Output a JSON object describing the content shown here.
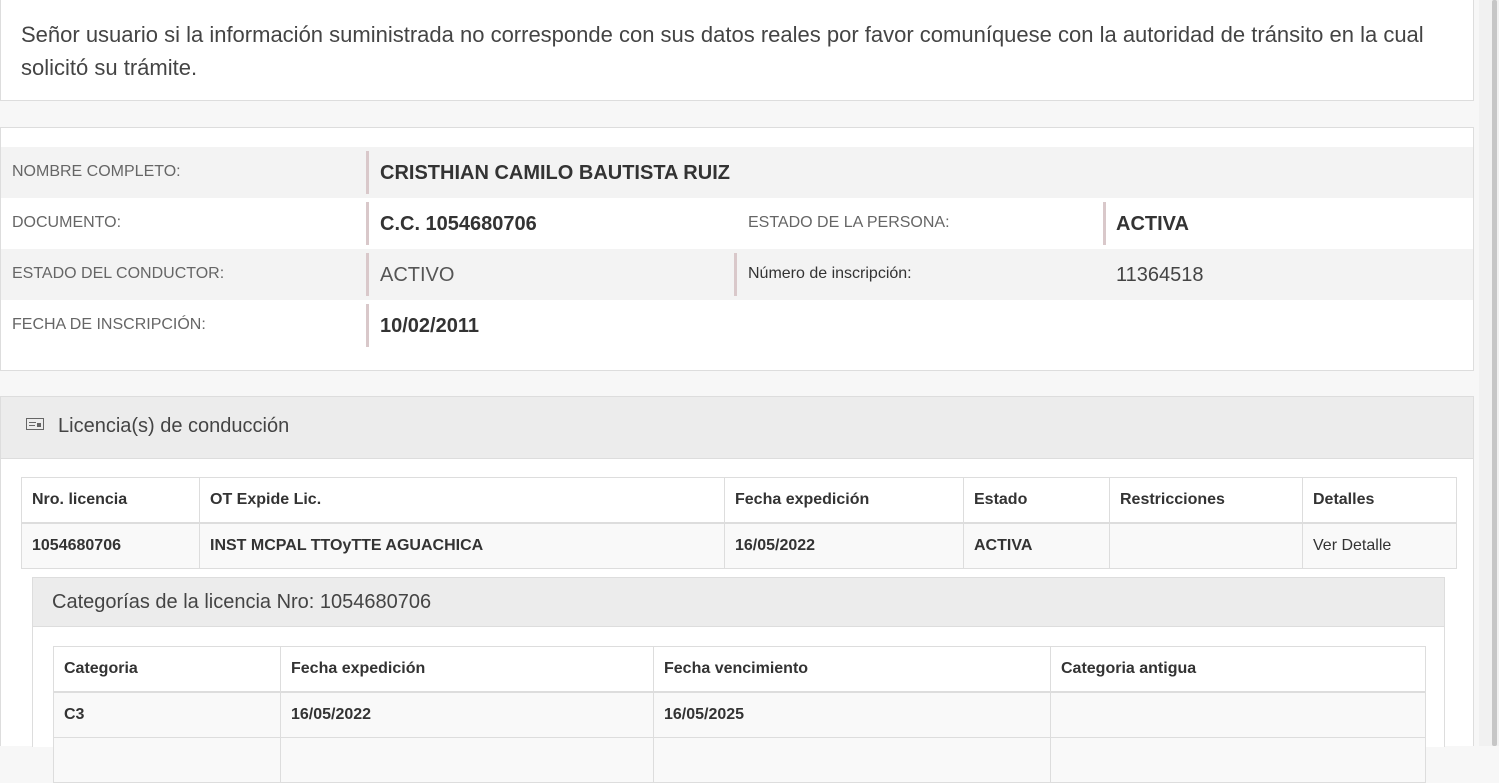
{
  "notice": {
    "text": "Señor usuario si la información suministrada no corresponde con sus datos reales por favor comuníquese con la autoridad de tránsito en la cual solicitó su trámite."
  },
  "person": {
    "nombre_label": "NOMBRE COMPLETO:",
    "nombre_value": "CRISTHIAN CAMILO BAUTISTA RUIZ",
    "documento_label": "DOCUMENTO:",
    "documento_value": "C.C. 1054680706",
    "estado_persona_label": "ESTADO DE LA PERSONA:",
    "estado_persona_value": "ACTIVA",
    "estado_conductor_label": "ESTADO DEL CONDUCTOR:",
    "estado_conductor_value": "ACTIVO",
    "inscripcion_label": "Número de inscripción:",
    "inscripcion_value": "11364518",
    "fecha_label": "FECHA DE INSCRIPCIÓN:",
    "fecha_value": "10/02/2011"
  },
  "licencias": {
    "title": "Licencia(s) de conducción",
    "icon": "id-card-icon",
    "headers": [
      "Nro. licencia",
      "OT Expide Lic.",
      "Fecha expedición",
      "Estado",
      "Restricciones",
      "Detalles"
    ],
    "rows": [
      {
        "nro": "1054680706",
        "ot": "INST MCPAL TTOyTTE AGUACHICA",
        "fecha": "16/05/2022",
        "estado": "ACTIVA",
        "restricciones": "",
        "detalles": "Ver Detalle"
      }
    ]
  },
  "categorias": {
    "title": "Categorías de la licencia Nro: 1054680706",
    "headers": [
      "Categoria",
      "Fecha expedición",
      "Fecha vencimiento",
      "Categoria antigua"
    ],
    "rows": [
      {
        "categoria": "C3",
        "expedicion": "16/05/2022",
        "vencimiento": "16/05/2025",
        "antigua": ""
      }
    ]
  }
}
